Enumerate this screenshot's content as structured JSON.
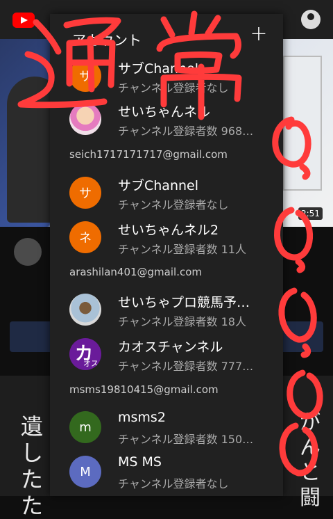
{
  "background": {
    "video_duration": "2:51",
    "thumbnail_text_left": "遺したた",
    "thumbnail_text_right": "がんと闘"
  },
  "panel": {
    "title": "アカウント",
    "add_icon": "plus-icon",
    "groups": [
      {
        "email": "",
        "accounts": [
          {
            "name": "サブChannel",
            "subtitle": "チャンネル登録者なし",
            "avatar_letter": "サ",
            "avatar_color": "#ef6c00"
          },
          {
            "name": "せいちゃんネル",
            "subtitle": "チャンネル登録者数 968…",
            "avatar_letter": "",
            "avatar_color": "#f0e0e8"
          }
        ]
      },
      {
        "email": "seich1717171717@gmail.com",
        "accounts": [
          {
            "name": "サブChannel",
            "subtitle": "チャンネル登録者なし",
            "avatar_letter": "サ",
            "avatar_color": "#ef6c00"
          },
          {
            "name": "せいちゃんネル2",
            "subtitle": "チャンネル登録者数 11人",
            "avatar_letter": "ネ",
            "avatar_color": "#ef6c00"
          }
        ]
      },
      {
        "email": "arashilan401@gmail.com",
        "accounts": [
          {
            "name": "せいちゃプロ競馬予…",
            "subtitle": "チャンネル登録者数 18人",
            "avatar_letter": "",
            "avatar_color": "#d8d8d8"
          },
          {
            "name": "カオスチャンネル",
            "subtitle": "チャンネル登録者数 777…",
            "avatar_letter": "カ",
            "avatar_color": "#6a1b9a",
            "avatar_small": "オス"
          }
        ]
      },
      {
        "email": "msms19810415@gmail.com",
        "accounts": [
          {
            "name": "msms2",
            "subtitle": "チャンネル登録者数 150…",
            "avatar_letter": "m",
            "avatar_color": "#33691e"
          },
          {
            "name": "MS MS",
            "subtitle": "チャンネル登録者なし",
            "avatar_letter": "M",
            "avatar_color": "#5c6bc0"
          }
        ]
      }
    ]
  },
  "overlay": {
    "scribble_text": "通常",
    "scribble_color": "#ff3b3b"
  }
}
